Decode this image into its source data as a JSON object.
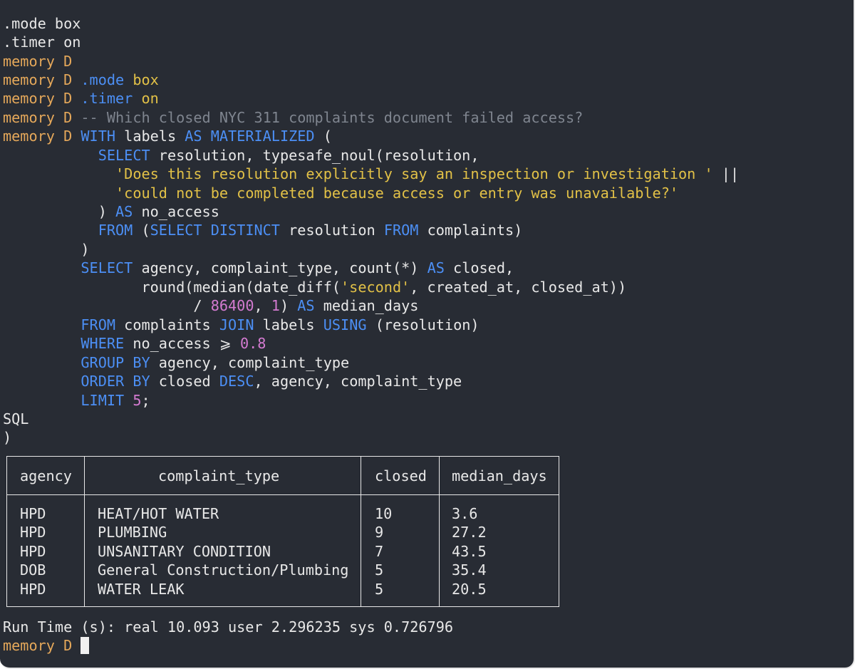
{
  "prompt_label": "memory D",
  "pre_lines": [
    ".mode box",
    ".timer on"
  ],
  "dot_commands": [
    {
      "cmd": ".mode",
      "arg": "box"
    },
    {
      "cmd": ".timer",
      "arg": "on"
    }
  ],
  "comment": "-- Which closed NYC 311 complaints document failed access?",
  "sql": {
    "with": "WITH",
    "labels": "labels",
    "as": "AS",
    "materialized": "MATERIALIZED",
    "open_paren": "(",
    "select": "SELECT",
    "select_cols": "resolution, typesafe_noul(resolution,",
    "prompt_str_1": "'Does this resolution explicitly say an inspection or investigation '",
    "concat_op": "||",
    "prompt_str_2": "'could not be completed because access or entry was unavailable?'",
    "close_paren": ")",
    "alias_no_access": "no_access",
    "from": "FROM",
    "subquery_open": "(",
    "distinct": "DISTINCT",
    "subquery_col": "resolution",
    "subquery_table": "complaints)",
    "main_cols": "agency, complaint_type, count(*)",
    "alias_closed": "closed,",
    "round_expr_pre": "round(median(date_diff(",
    "second_str": "'second'",
    "round_expr_post": ", created_at, closed_at))",
    "divide": "/",
    "divisor": "86400",
    "round_digits_pre": ",",
    "round_digits": "1",
    "round_close": ")",
    "alias_median": "median_days",
    "from_clause": "complaints",
    "join": "JOIN",
    "join_table": "labels",
    "using": "USING",
    "using_col": "(resolution)",
    "where": "WHERE",
    "where_expr": "no_access ⩾",
    "threshold": "0.8",
    "group_by": "GROUP BY",
    "group_cols": "agency, complaint_type",
    "order_by": "ORDER BY",
    "order_col_1": "closed",
    "desc": "DESC",
    "order_cols_rest": ", agency, complaint_type",
    "limit": "LIMIT",
    "limit_val": "5",
    "semicolon": ";"
  },
  "heredoc_end": "SQL",
  "closing_paren": ")",
  "table": {
    "headers": [
      "agency",
      "complaint_type",
      "closed",
      "median_days"
    ],
    "rows": [
      [
        "HPD",
        "HEAT/HOT WATER",
        "10",
        "3.6"
      ],
      [
        "HPD",
        "PLUMBING",
        "9",
        "27.2"
      ],
      [
        "HPD",
        "UNSANITARY CONDITION",
        "7",
        "43.5"
      ],
      [
        "DOB",
        "General Construction/Plumbing",
        "5",
        "35.4"
      ],
      [
        "HPD",
        "WATER LEAK",
        "5",
        "20.5"
      ]
    ]
  },
  "run_time": "Run Time (s): real 10.093 user 2.296235 sys 0.726796",
  "colors": {
    "background": "#282c34",
    "prompt": "#e5a85a",
    "keyword": "#4c8ff5",
    "string": "#e2c147",
    "number": "#d47bd1",
    "comment": "#7f858f",
    "text": "#e8e8e8"
  }
}
